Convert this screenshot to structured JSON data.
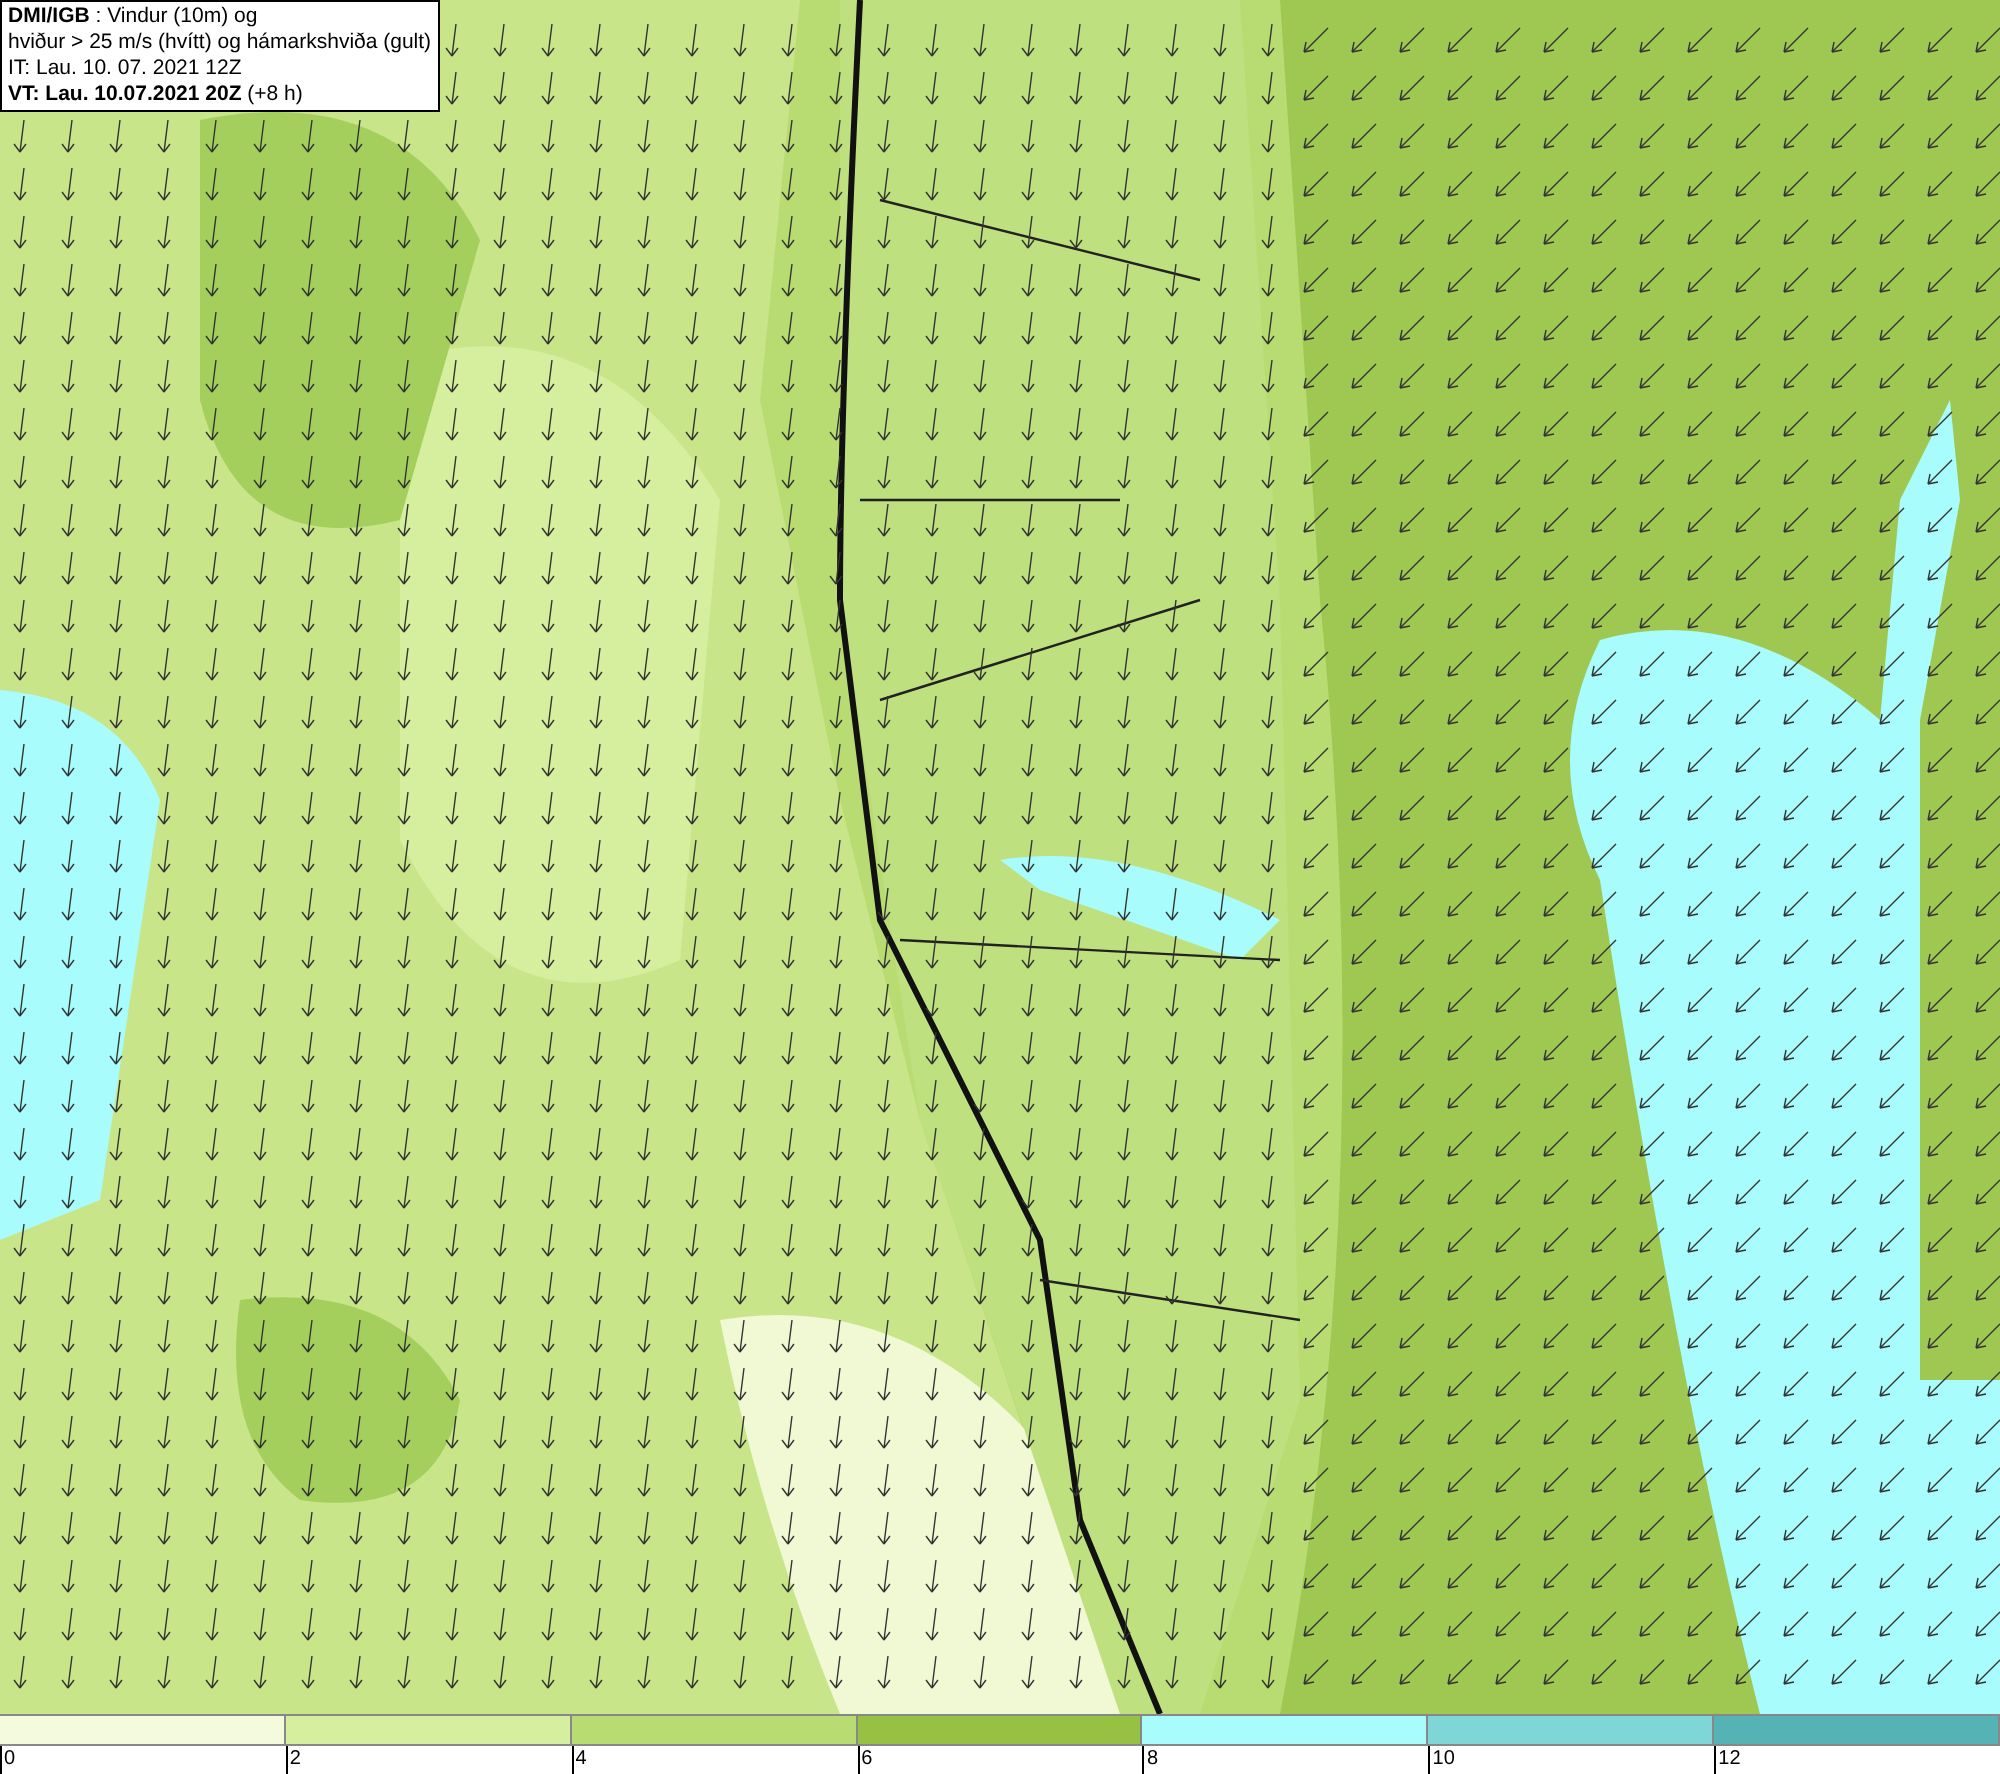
{
  "info_box": {
    "lines": [
      "**DMI/IGB** : Vindur (10m) og",
      "hviður > 25 m/s (hvítt) og hámarkshviða (gult)",
      "IT: Lau. 10. 07. 2021 12Z",
      "**VT: Lau. 10.07.2021 20Z** (+8 h)"
    ]
  },
  "legend": {
    "segments": [
      {
        "color": "#f4fbdc"
      },
      {
        "color": "#d5ef9e"
      },
      {
        "color": "#b8dc72"
      },
      {
        "color": "#96c143"
      },
      {
        "color": "#a8fcfc"
      },
      {
        "color": "#7fd6d6"
      },
      {
        "color": "#55b3b5"
      }
    ],
    "ticks": [
      "0",
      "2",
      "4",
      "6",
      "8",
      "10",
      "12"
    ]
  }
}
